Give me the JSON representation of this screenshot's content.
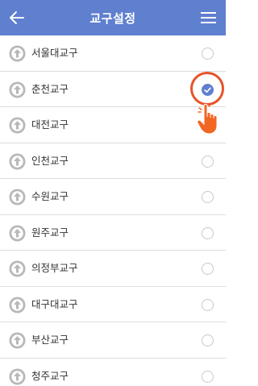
{
  "header": {
    "title": "교구설정",
    "back_icon": "back-arrow-icon",
    "menu_icon": "hamburger-menu-icon"
  },
  "colors": {
    "header_bg": "#5f7fcf",
    "accent": "#5f7fcf",
    "highlight": "#e8522a"
  },
  "items": [
    {
      "label": "서울대교구",
      "checked": false
    },
    {
      "label": "춘천교구",
      "checked": true
    },
    {
      "label": "대전교구",
      "checked": false
    },
    {
      "label": "인천교구",
      "checked": false
    },
    {
      "label": "수원교구",
      "checked": false
    },
    {
      "label": "원주교구",
      "checked": false
    },
    {
      "label": "의정부교구",
      "checked": false
    },
    {
      "label": "대구대교구",
      "checked": false
    },
    {
      "label": "부산교구",
      "checked": false
    },
    {
      "label": "청주교구",
      "checked": false
    }
  ]
}
